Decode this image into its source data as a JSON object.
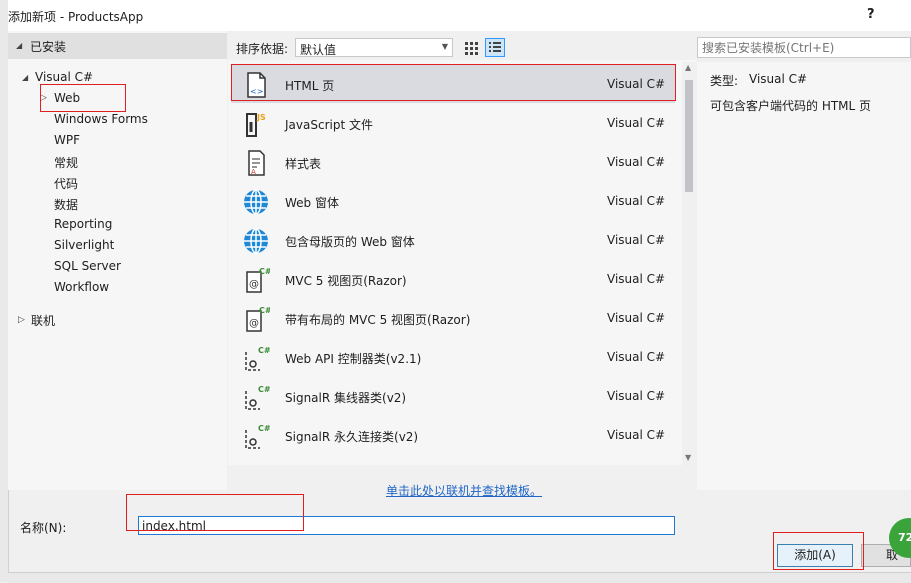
{
  "window": {
    "title": "添加新项 - ProductsApp",
    "help": "?"
  },
  "tree": {
    "installed": "已安装",
    "visual_csharp": "Visual C#",
    "children": [
      "Web",
      "Windows Forms",
      "WPF",
      "常规",
      "代码",
      "数据",
      "Reporting",
      "Silverlight",
      "SQL Server",
      "Workflow"
    ],
    "online": "联机"
  },
  "toolbar": {
    "sort_label": "排序依据:",
    "sort_value": "默认值"
  },
  "templates": [
    {
      "name": "HTML 页",
      "type": "Visual C#",
      "icon": "html-page-icon"
    },
    {
      "name": "JavaScript 文件",
      "type": "Visual C#",
      "icon": "javascript-file-icon"
    },
    {
      "name": "样式表",
      "type": "Visual C#",
      "icon": "stylesheet-icon"
    },
    {
      "name": "Web 窗体",
      "type": "Visual C#",
      "icon": "web-globe-icon"
    },
    {
      "name": "包含母版页的 Web 窗体",
      "type": "Visual C#",
      "icon": "web-globe-icon"
    },
    {
      "name": "MVC 5 视图页(Razor)",
      "type": "Visual C#",
      "icon": "razor-view-icon"
    },
    {
      "name": "带有布局的 MVC 5 视图页(Razor)",
      "type": "Visual C#",
      "icon": "razor-view-icon"
    },
    {
      "name": "Web API 控制器类(v2.1)",
      "type": "Visual C#",
      "icon": "class-file-icon"
    },
    {
      "name": "SignalR 集线器类(v2)",
      "type": "Visual C#",
      "icon": "class-file-icon"
    },
    {
      "name": "SignalR 永久连接类(v2)",
      "type": "Visual C#",
      "icon": "class-file-icon"
    }
  ],
  "search": {
    "placeholder": "搜索已安装模板(Ctrl+E)"
  },
  "details": {
    "type_label": "类型:",
    "type_value": "Visual C#",
    "description": "可包含客户端代码的 HTML 页"
  },
  "online_link": "单击此处以联机并查找模板。",
  "name_field": {
    "label": "名称(N):",
    "value": "index.html"
  },
  "buttons": {
    "add": "添加(A)",
    "cancel": "取"
  },
  "badge": "72",
  "colors": {
    "selection": "#dadbe0",
    "accent": "#1f7ad6",
    "link": "#1f66c7",
    "highlight": "#e02020"
  }
}
